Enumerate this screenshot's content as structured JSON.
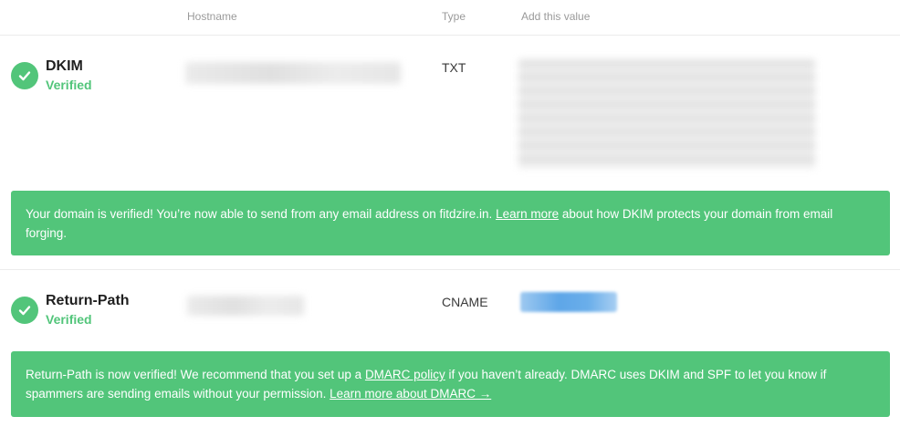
{
  "table_header": {
    "hostname": "Hostname",
    "type": "Type",
    "value": "Add this value"
  },
  "records": [
    {
      "name": "DKIM",
      "status": "Verified",
      "type": "TXT",
      "notice": {
        "text_before": "Your domain is verified! You’re now able to send from any email address on fitdzire.in.",
        "link1": "Learn more",
        "text_after": " about how DKIM protects your domain from email forging."
      }
    },
    {
      "name": "Return-Path",
      "status": "Verified",
      "type": "CNAME",
      "notice": {
        "text_before": "Return-Path is now verified! We recommend that you set up a ",
        "link1": "DMARC policy",
        "text_middle": " if you haven’t already. DMARC uses DKIM and SPF to let you know if spammers are sending emails without your permission. ",
        "link2": "Learn more about DMARC →"
      }
    }
  ],
  "colors": {
    "success_green": "#52c57a",
    "redacted_value_blue": "#5ea6e8"
  },
  "icons": [
    "check-circle-icon"
  ]
}
